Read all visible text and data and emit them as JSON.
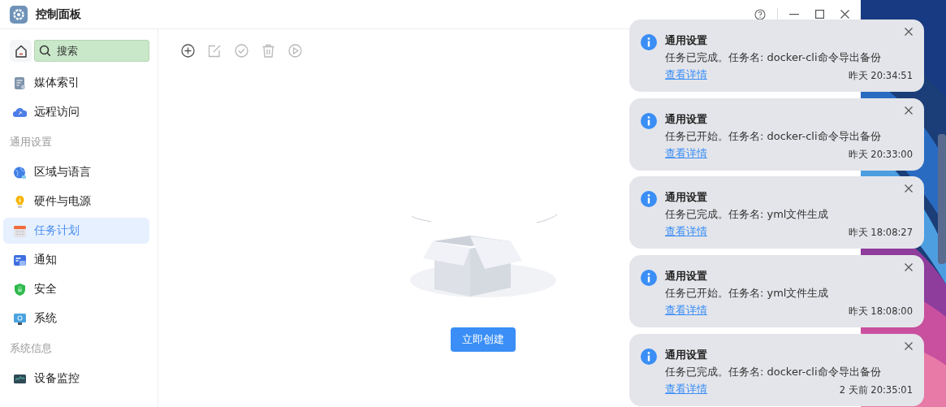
{
  "window": {
    "title": "控制面板"
  },
  "sidebar": {
    "search": {
      "placeholder": "搜索"
    },
    "entries": [
      {
        "kind": "item",
        "label": "媒体索引",
        "selected": false
      },
      {
        "kind": "item",
        "label": "远程访问",
        "selected": false
      },
      {
        "kind": "heading",
        "label": "通用设置"
      },
      {
        "kind": "item",
        "label": "区域与语言",
        "selected": false
      },
      {
        "kind": "item",
        "label": "硬件与电源",
        "selected": false
      },
      {
        "kind": "item",
        "label": "任务计划",
        "selected": true
      },
      {
        "kind": "item",
        "label": "通知",
        "selected": false
      },
      {
        "kind": "item",
        "label": "安全",
        "selected": false
      },
      {
        "kind": "item",
        "label": "系统",
        "selected": false
      },
      {
        "kind": "heading",
        "label": "系统信息"
      },
      {
        "kind": "item",
        "label": "设备监控",
        "selected": false
      }
    ]
  },
  "toolbar": [
    {
      "disabled": false
    },
    {
      "disabled": true
    },
    {
      "disabled": true
    },
    {
      "disabled": true
    },
    {
      "disabled": true
    }
  ],
  "empty_state": {
    "button": "立即创建"
  },
  "notifications": [
    {
      "title": "通用设置",
      "message": "任务已完成。任务名: docker-cli命令导出备份",
      "link": "查看详情",
      "time": "昨天 20:34:51"
    },
    {
      "title": "通用设置",
      "message": "任务已开始。任务名: docker-cli命令导出备份",
      "link": "查看详情",
      "time": "昨天 20:33:00"
    },
    {
      "title": "通用设置",
      "message": "任务已完成。任务名: yml文件生成",
      "link": "查看详情",
      "time": "昨天 18:08:27"
    },
    {
      "title": "通用设置",
      "message": "任务已开始。任务名: yml文件生成",
      "link": "查看详情",
      "time": "昨天 18:08:00"
    },
    {
      "title": "通用设置",
      "message": "任务已完成。任务名: docker-cli命令导出备份",
      "link": "查看详情",
      "time": "2 天前 20:35:01"
    }
  ]
}
